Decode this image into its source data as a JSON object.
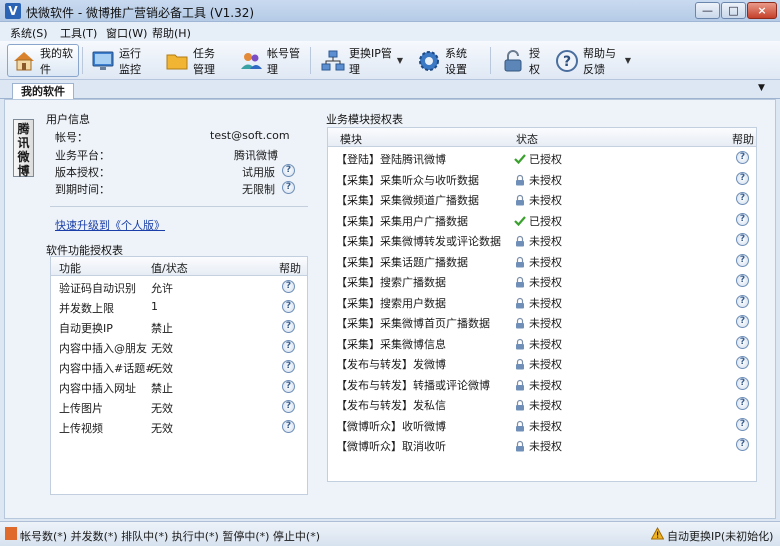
{
  "window": {
    "title": "快微软件 - 微博推广营销必备工具 (V1.32)",
    "app_icon_letter": "V",
    "controls": {
      "minimize": "—",
      "maximize": "□",
      "close": "×"
    }
  },
  "menubar": {
    "items": [
      "系统(S)",
      "工具(T)",
      "窗口(W)",
      "帮助(H)"
    ]
  },
  "toolbar": {
    "items": [
      {
        "label": "我的软件",
        "icon": "home-icon"
      },
      {
        "label": "运行监控",
        "icon": "monitor-icon"
      },
      {
        "label": "任务管理",
        "icon": "folder-icon"
      },
      {
        "label": "帐号管理",
        "icon": "users-icon"
      },
      {
        "label": "更换IP管理",
        "icon": "network-icon"
      },
      {
        "label": "系统设置",
        "icon": "gear-icon"
      },
      {
        "label": "授权",
        "icon": "lock-icon"
      },
      {
        "label": "帮助与反馈",
        "icon": "help-icon"
      }
    ]
  },
  "tabs": {
    "active": "我的软件",
    "overflow_arrow": "▼"
  },
  "vertical_tab": {
    "label": "腾讯微博"
  },
  "user_info": {
    "title": "用户信息",
    "rows": [
      {
        "label": "帐号：",
        "value": "test@soft.com"
      },
      {
        "label": "业务平台：",
        "value": "腾讯微博"
      },
      {
        "label": "版本授权：",
        "value": "试用版"
      },
      {
        "label": "到期时间：",
        "value": "无限制"
      }
    ],
    "upgrade_link": "快速升级到《个人版》"
  },
  "function_table": {
    "title": "软件功能授权表",
    "headers": {
      "function": "功能",
      "value": "值/状态",
      "help": "帮助"
    },
    "rows": [
      {
        "name": "验证码自动识别",
        "value": "允许"
      },
      {
        "name": "并发数上限",
        "value": "1"
      },
      {
        "name": "自动更换IP",
        "value": "禁止"
      },
      {
        "name": "内容中插入@朋友",
        "value": "无效"
      },
      {
        "name": "内容中插入#话题#",
        "value": "无效"
      },
      {
        "name": "内容中插入网址",
        "value": "禁止"
      },
      {
        "name": "上传图片",
        "value": "无效"
      },
      {
        "name": "上传视频",
        "value": "无效"
      }
    ]
  },
  "module_table": {
    "title": "业务模块授权表",
    "headers": {
      "module": "模块",
      "status": "状态",
      "help": "帮助"
    },
    "rows": [
      {
        "name": "【登陆】登陆腾讯微博",
        "status": "已授权",
        "authorized": true
      },
      {
        "name": "【采集】采集听众与收听数据",
        "status": "未授权",
        "authorized": false
      },
      {
        "name": "【采集】采集微频道广播数据",
        "status": "未授权",
        "authorized": false
      },
      {
        "name": "【采集】采集用户广播数据",
        "status": "已授权",
        "authorized": true
      },
      {
        "name": "【采集】采集微博转发或评论数据",
        "status": "未授权",
        "authorized": false
      },
      {
        "name": "【采集】采集话题广播数据",
        "status": "未授权",
        "authorized": false
      },
      {
        "name": "【采集】搜索广播数据",
        "status": "未授权",
        "authorized": false
      },
      {
        "name": "【采集】搜索用户数据",
        "status": "未授权",
        "authorized": false
      },
      {
        "name": "【采集】采集微博首页广播数据",
        "status": "未授权",
        "authorized": false
      },
      {
        "name": "【采集】采集微博信息",
        "status": "未授权",
        "authorized": false
      },
      {
        "name": "【发布与转发】发微博",
        "status": "未授权",
        "authorized": false
      },
      {
        "name": "【发布与转发】转播或评论微博",
        "status": "未授权",
        "authorized": false
      },
      {
        "name": "【发布与转发】发私信",
        "status": "未授权",
        "authorized": false
      },
      {
        "name": "【微博听众】收听微博",
        "status": "未授权",
        "authorized": false
      },
      {
        "name": "【微博听众】取消收听",
        "status": "未授权",
        "authorized": false
      }
    ]
  },
  "statusbar": {
    "text": "帐号数(*) 并发数(*) 排队中(*) 执行中(*) 暂停中(*) 停止中(*)",
    "ip_status": "自动更换IP(未初始化)"
  },
  "colors": {
    "accent": "#2b63b5",
    "link": "#1a3fa8",
    "authorized": "#3aa12e",
    "locked": "#6f8fb8"
  }
}
